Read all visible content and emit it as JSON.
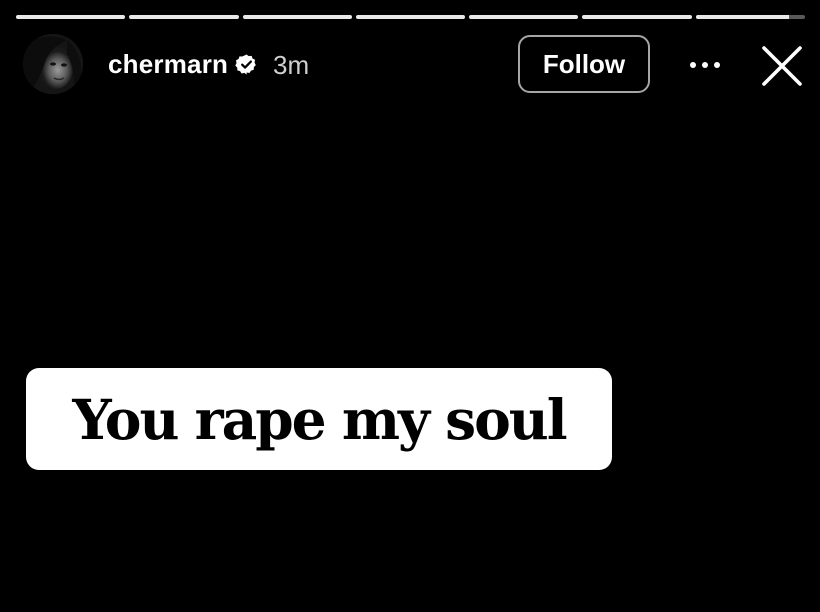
{
  "story": {
    "segments": [
      {
        "progress": 1
      },
      {
        "progress": 1
      },
      {
        "progress": 1
      },
      {
        "progress": 1
      },
      {
        "progress": 1
      },
      {
        "progress": 1
      },
      {
        "progress": 0.85
      }
    ]
  },
  "header": {
    "username": "chermarn",
    "verified": true,
    "timestamp": "3m",
    "follow_label": "Follow"
  },
  "icons": {
    "verified": "verified-badge-icon",
    "more": "more-options-icon",
    "close": "close-icon"
  },
  "content": {
    "sticker_text": "You rape my soul"
  },
  "colors": {
    "background": "#000000",
    "sticker_background": "#ffffff",
    "sticker_text": "#000000",
    "text": "#ffffff"
  }
}
